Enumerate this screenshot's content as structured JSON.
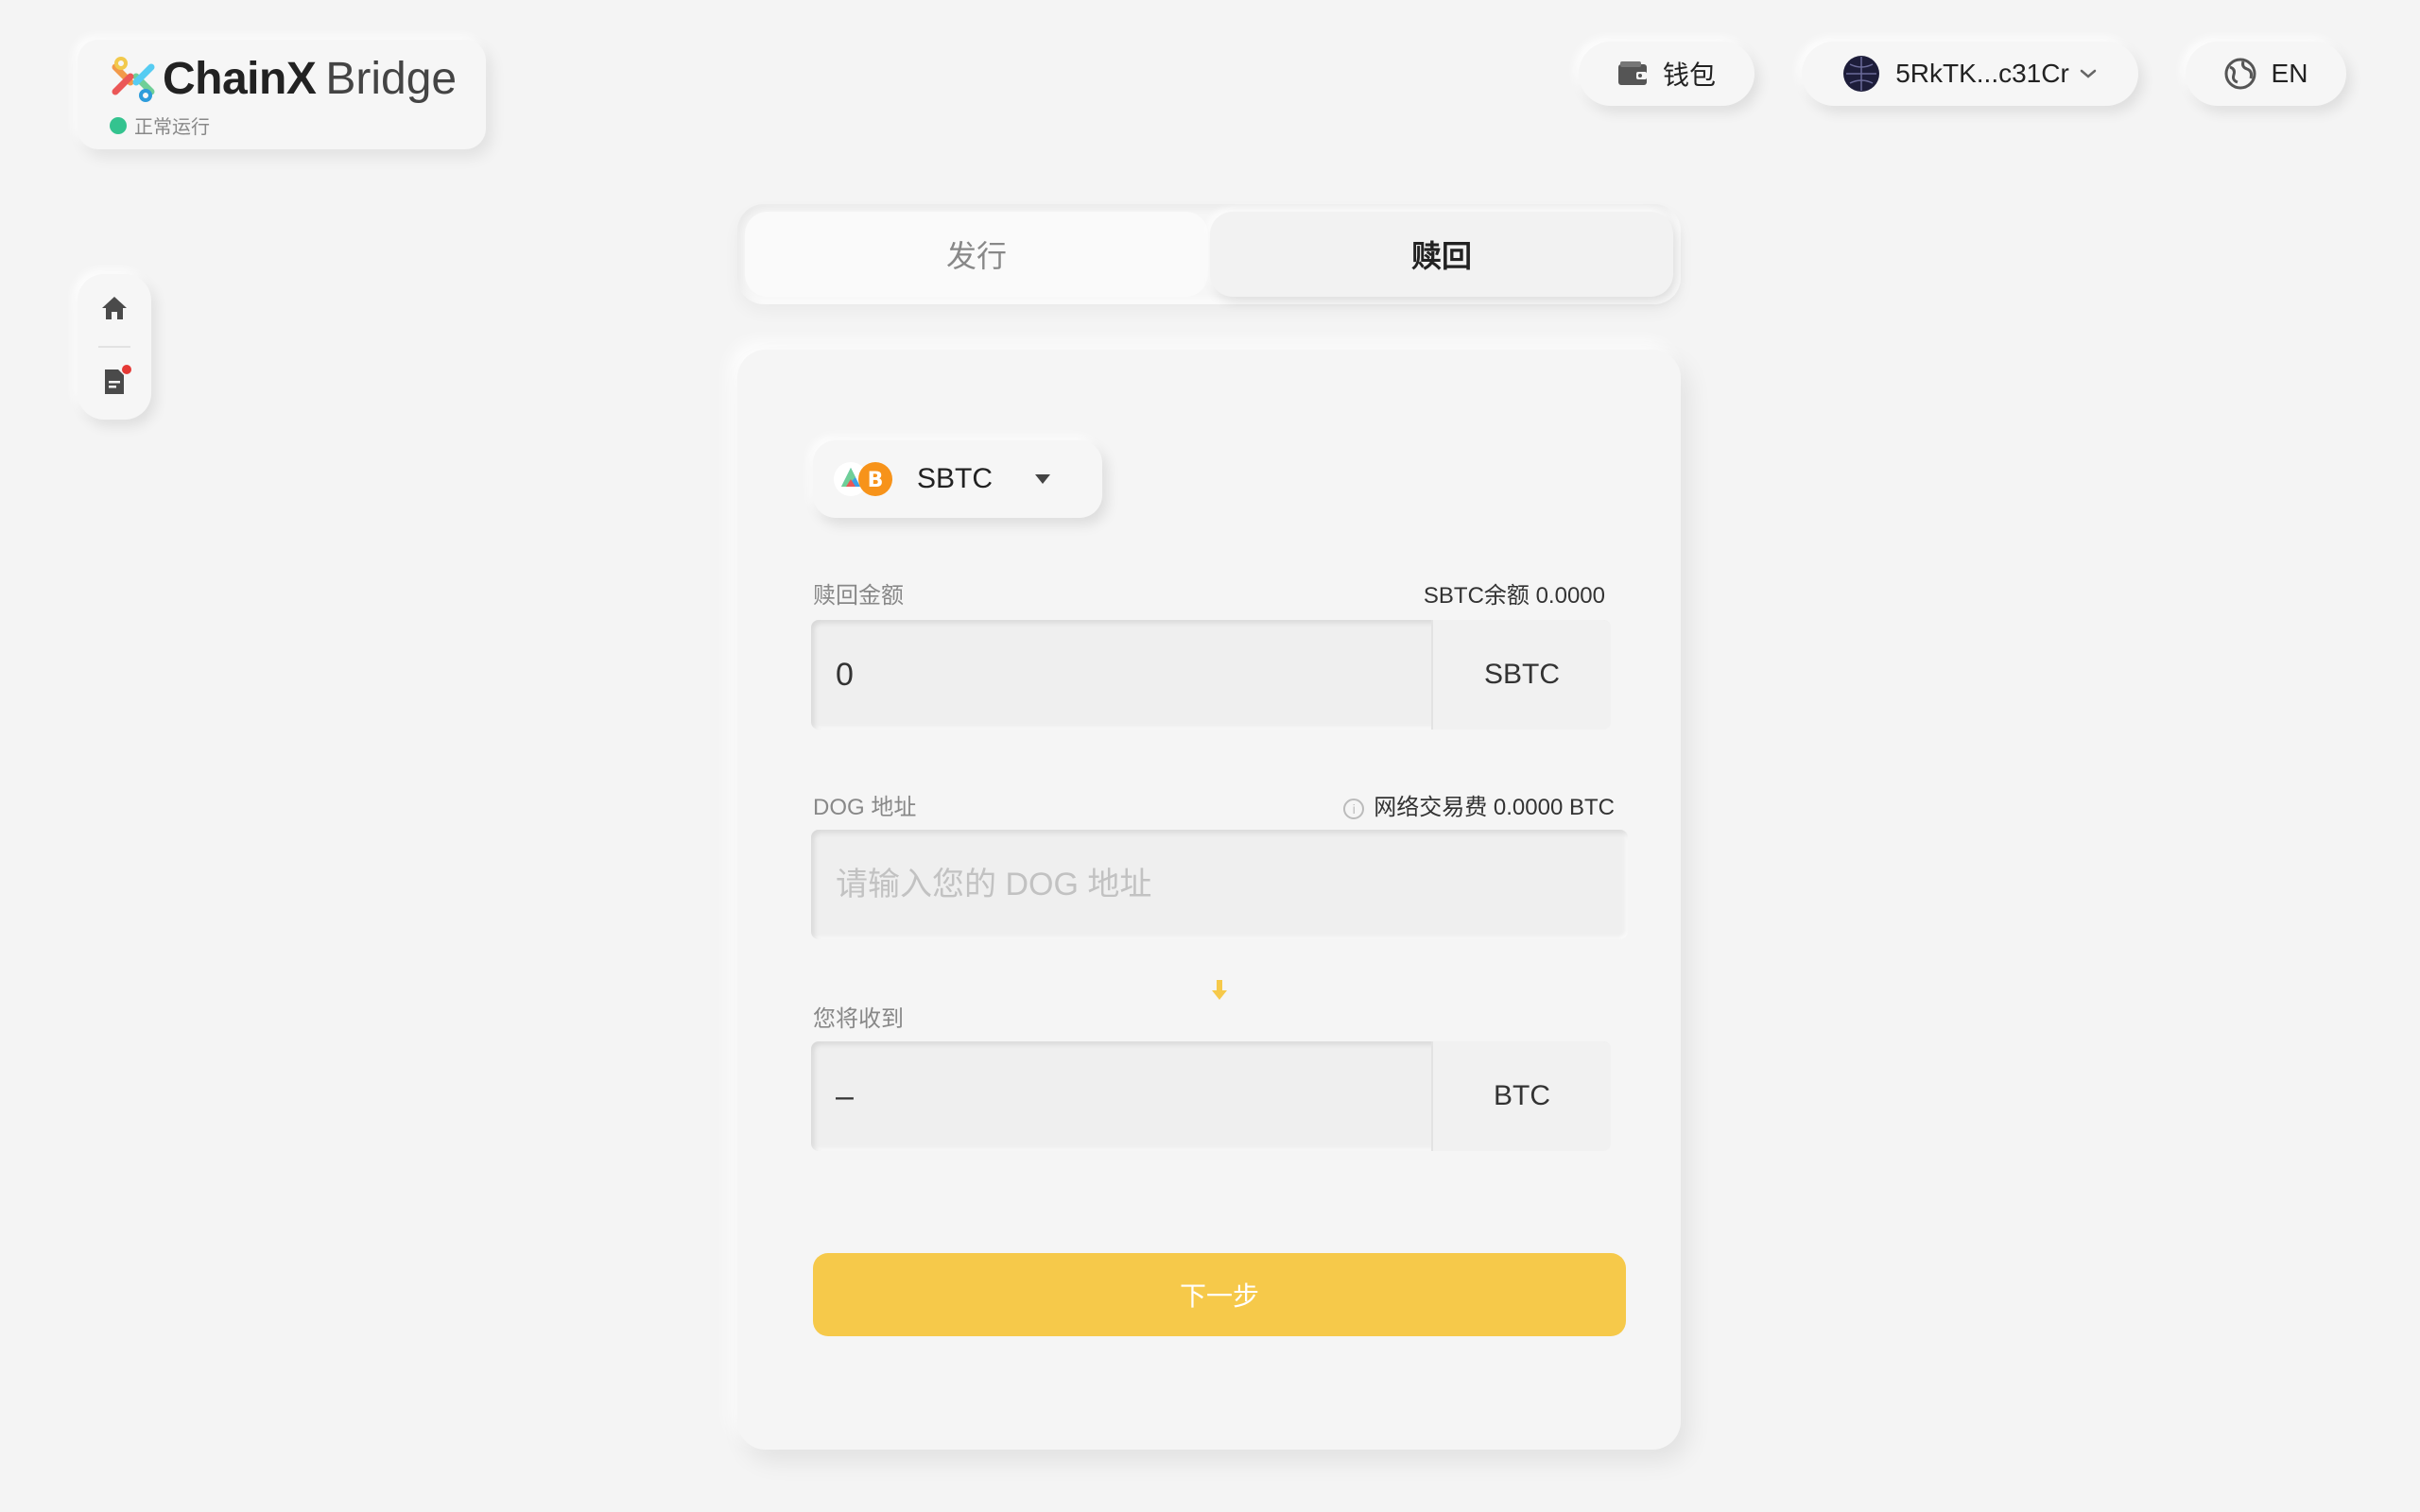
{
  "app": {
    "brand_bold": "ChainX",
    "brand_light": "Bridge",
    "status": "正常运行",
    "status_color": "#34c38f"
  },
  "topbar": {
    "wallet_label": "钱包",
    "wallet_icon": "wallet-icon",
    "account_label": "5RkTK...c31Cr",
    "account_icon": "account-avatar-icon",
    "language_label": "EN",
    "language_icon": "globe-icon"
  },
  "sidebar": {
    "items": [
      {
        "name": "home",
        "icon": "home-icon"
      },
      {
        "name": "records",
        "icon": "document-icon",
        "has_notification": true
      }
    ]
  },
  "tabs": [
    {
      "label": "发行",
      "active": false
    },
    {
      "label": "赎回",
      "active": true
    }
  ],
  "form": {
    "token": {
      "name": "SBTC",
      "icon": "sbtc-token-icon"
    },
    "amount": {
      "label": "赎回金额",
      "balance_text": "SBTC余额 0.0000",
      "value": "0",
      "unit": "SBTC"
    },
    "address": {
      "label": "DOG 地址",
      "fee_text": "网络交易费 0.0000 BTC",
      "placeholder": "请输入您的 DOG 地址"
    },
    "receive": {
      "label": "您将收到",
      "value": "–",
      "unit": "BTC"
    },
    "next_button": "下一步"
  },
  "colors": {
    "accent": "#f6c94a",
    "background": "#f4f4f4",
    "notification": "#e53935"
  }
}
